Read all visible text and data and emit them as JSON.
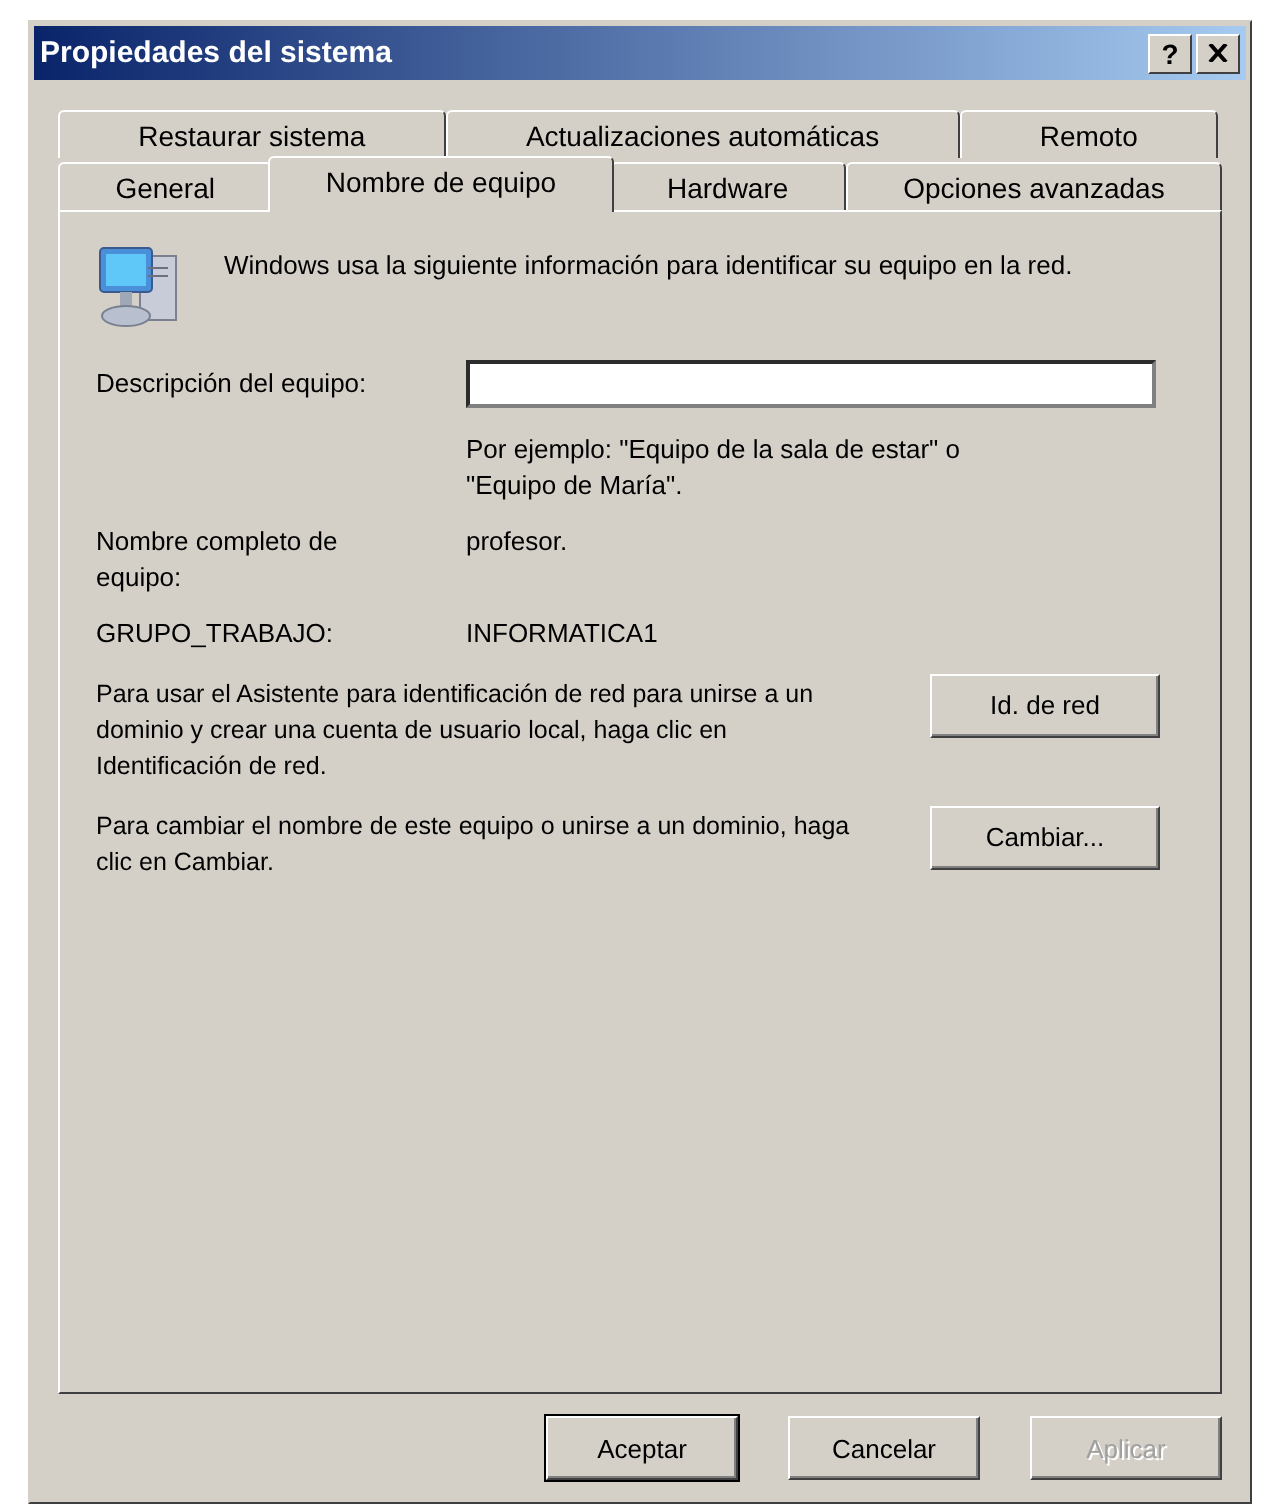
{
  "window": {
    "title": "Propiedades del sistema",
    "help_button": "?"
  },
  "tabs": [
    [
      {
        "label": "Restaurar sistema",
        "selected": false
      },
      {
        "label": "Actualizaciones automáticas",
        "selected": false
      },
      {
        "label": "Remoto",
        "selected": false
      }
    ],
    [
      {
        "label": "General",
        "selected": false
      },
      {
        "label": "Nombre de equipo",
        "selected": true
      },
      {
        "label": "Hardware",
        "selected": false
      },
      {
        "label": "Opciones avanzadas",
        "selected": false
      }
    ]
  ],
  "intro": "Windows usa la siguiente información para identificar su equipo en la red.",
  "description": {
    "label": "Descripción del equipo:",
    "hint": "Por ejemplo: \"Equipo de la sala de estar\" o \"Equipo de María\"."
  },
  "info": [
    {
      "label": "Nombre completo de equipo:",
      "value": "profesor."
    },
    {
      "label": "GRUPO_TRABAJO:",
      "value": "INFORMATICA1"
    }
  ],
  "actions": [
    {
      "text": "Para usar el Asistente para identificación de red para unirse a un dominio y crear una cuenta de usuario local, haga clic en Identificación de red.",
      "button": "Id. de red"
    },
    {
      "text": "Para cambiar el nombre de este equipo o unirse a un dominio, haga clic en Cambiar.",
      "button": "Cambiar..."
    }
  ],
  "buttons": [
    {
      "label": "Aceptar",
      "default": true,
      "disabled": false
    },
    {
      "label": "Cancelar",
      "default": false,
      "disabled": false
    },
    {
      "label": "Aplicar",
      "default": false,
      "disabled": true
    }
  ]
}
